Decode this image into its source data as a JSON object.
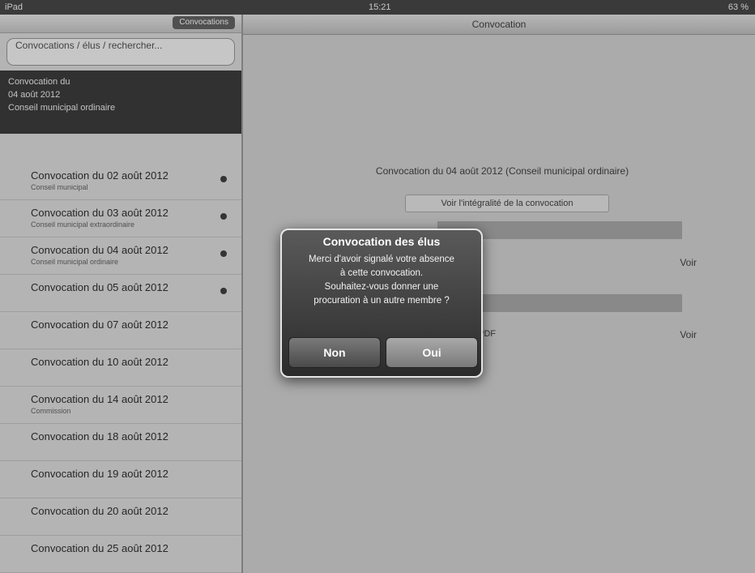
{
  "statusbar": {
    "carrier": "iPad",
    "time": "15:21",
    "battery": "63 %"
  },
  "sidebar": {
    "top_button": "Convocations",
    "search_text": "Convocations / élus / rechercher...",
    "selected": {
      "line1": "Convocation du",
      "line2": "04 août 2012",
      "line3": "Conseil municipal ordinaire"
    },
    "items": [
      {
        "title": "Convocation du 02 août 2012",
        "sub": "Conseil municipal"
      },
      {
        "title": "Convocation du 03 août 2012",
        "sub": "Conseil municipal extraordinaire"
      },
      {
        "title": "Convocation du 04 août 2012",
        "sub": "Conseil municipal ordinaire"
      },
      {
        "title": "Convocation du 05 août 2012",
        "sub": ""
      },
      {
        "title": "Convocation du 07 août 2012",
        "sub": ""
      },
      {
        "title": "Convocation du 10 août 2012",
        "sub": ""
      },
      {
        "title": "Convocation du 14 août 2012",
        "sub": "Commission"
      },
      {
        "title": "Convocation du 18 août 2012",
        "sub": ""
      },
      {
        "title": "Convocation du 19 août 2012",
        "sub": ""
      },
      {
        "title": "Convocation du 20 août 2012",
        "sub": ""
      },
      {
        "title": "Convocation du 25 août 2012",
        "sub": ""
      }
    ]
  },
  "main": {
    "nav_title": "Convocation",
    "heading": "Convocation du 04 août 2012 (Conseil municipal ordinaire)",
    "full_link": "Voir l'intégralité de la convocation",
    "voir_label": "Voir",
    "pdf_label": "PDF"
  },
  "alert": {
    "title": "Convocation des élus",
    "message_line1": "Merci d'avoir signalé votre absence",
    "message_line2": "à cette convocation.",
    "message_line3": "Souhaitez-vous donner une",
    "message_line4": "procuration à un autre membre ?",
    "button_no": "Non",
    "button_yes": "Oui"
  }
}
